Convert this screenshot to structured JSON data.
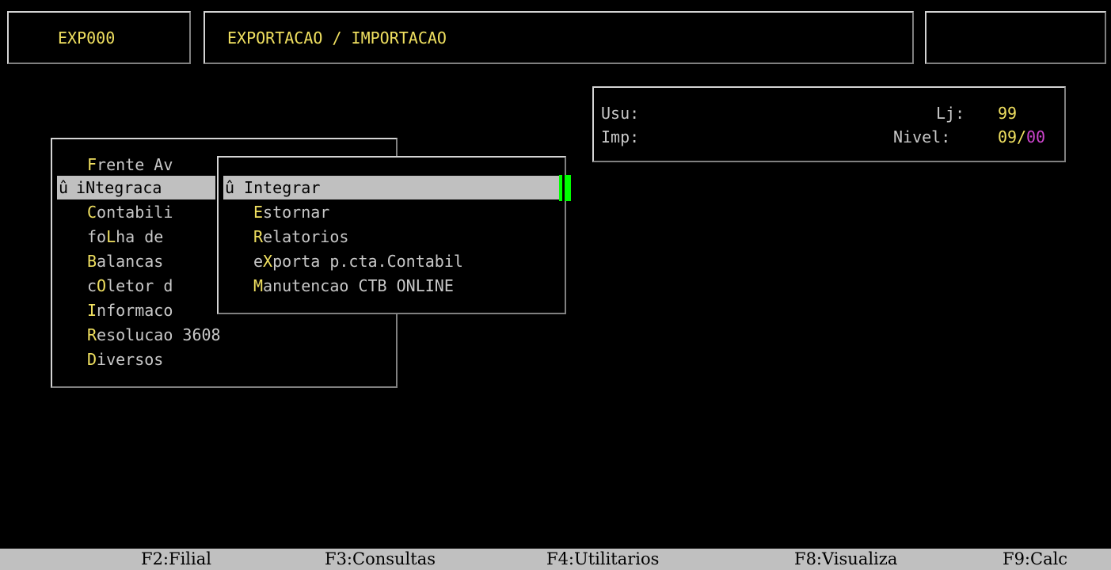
{
  "header": {
    "screen_code": "EXP000",
    "title": "EXPORTACAO / IMPORTACAO"
  },
  "info": {
    "usu_label": "Usu:",
    "imp_label": "Imp:",
    "lj_label": "Lj:",
    "lj_value": "99",
    "nivel_label": "Nivel:",
    "nivel_value_a": "09",
    "nivel_sep": "/",
    "nivel_value_b": "00"
  },
  "main_menu": {
    "items": [
      {
        "marker": " ",
        "hot": "F",
        "rest": "rente Av"
      },
      {
        "marker": "û",
        "pre": " i",
        "hot": "N",
        "rest": "tegraca"
      },
      {
        "marker": " ",
        "hot": "C",
        "rest": "ontabili"
      },
      {
        "marker": " ",
        "pre": "fo",
        "hot": "L",
        "rest": "ha de"
      },
      {
        "marker": " ",
        "hot": "B",
        "rest": "alancas"
      },
      {
        "marker": " ",
        "pre": "c",
        "hot": "O",
        "rest": "letor d"
      },
      {
        "marker": " ",
        "hot": "I",
        "rest": "nformaco"
      },
      {
        "marker": " ",
        "hot": "R",
        "rest": "esolucao 3608"
      },
      {
        "marker": " ",
        "hot": "D",
        "rest": "iversos"
      }
    ]
  },
  "sub_menu": {
    "items": [
      {
        "marker": "û",
        "hot": "",
        "rest": " Integrar"
      },
      {
        "marker": " ",
        "hot": "E",
        "rest": "stornar"
      },
      {
        "marker": " ",
        "hot": "R",
        "rest": "elatorios"
      },
      {
        "marker": " ",
        "pre": "e",
        "hot": "X",
        "rest": "porta p.cta.Contabil"
      },
      {
        "marker": " ",
        "hot": "M",
        "rest": "anutencao CTB ONLINE"
      }
    ]
  },
  "footer": {
    "keys": [
      "F2:Filial",
      "F3:Consultas",
      "F4:Utilitarios",
      "F8:Visualiza",
      "F9:Calc"
    ]
  },
  "colors": {
    "background": "#000000",
    "text": "#c8c8c8",
    "hotkey": "#f0e060",
    "selection": "#c0c0c0",
    "cursor": "#00ff00",
    "nivel_b": "#cc44cc"
  }
}
